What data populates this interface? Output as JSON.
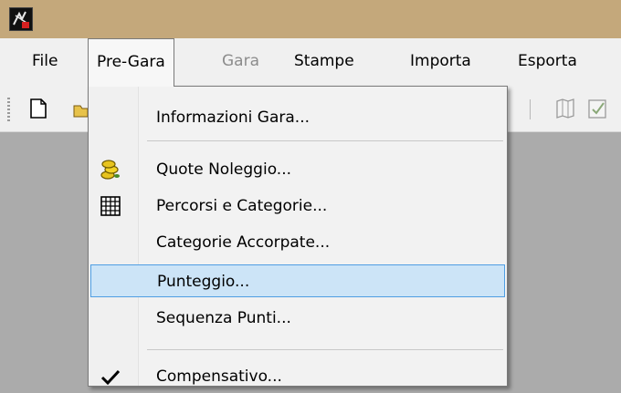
{
  "menubar": {
    "items": [
      {
        "label": "File"
      },
      {
        "label": "Pre-Gara"
      },
      {
        "label": "Gara"
      },
      {
        "label": "Stampe"
      },
      {
        "label": "Importa"
      },
      {
        "label": "Esporta"
      }
    ]
  },
  "dropdown": {
    "items": [
      {
        "label": "Informazioni Gara...",
        "icon": null
      },
      {
        "label": "Quote Noleggio...",
        "icon": "coins-icon"
      },
      {
        "label": "Percorsi e Categorie...",
        "icon": "grid-table-icon"
      },
      {
        "label": "Categorie Accorpate...",
        "icon": null
      },
      {
        "label": "Punteggio...",
        "icon": null,
        "highlighted": true
      },
      {
        "label": "Sequenza Punti...",
        "icon": null
      },
      {
        "label": "Compensativo...",
        "icon": "checkmark-icon"
      }
    ]
  },
  "colors": {
    "titlebar": "#c4a87b",
    "menubar": "#f0f0f0",
    "workspace": "#ababab",
    "highlight_bg": "#cce4f7",
    "highlight_border": "#4f9ee3",
    "disabled_text": "#8c8c8c"
  }
}
